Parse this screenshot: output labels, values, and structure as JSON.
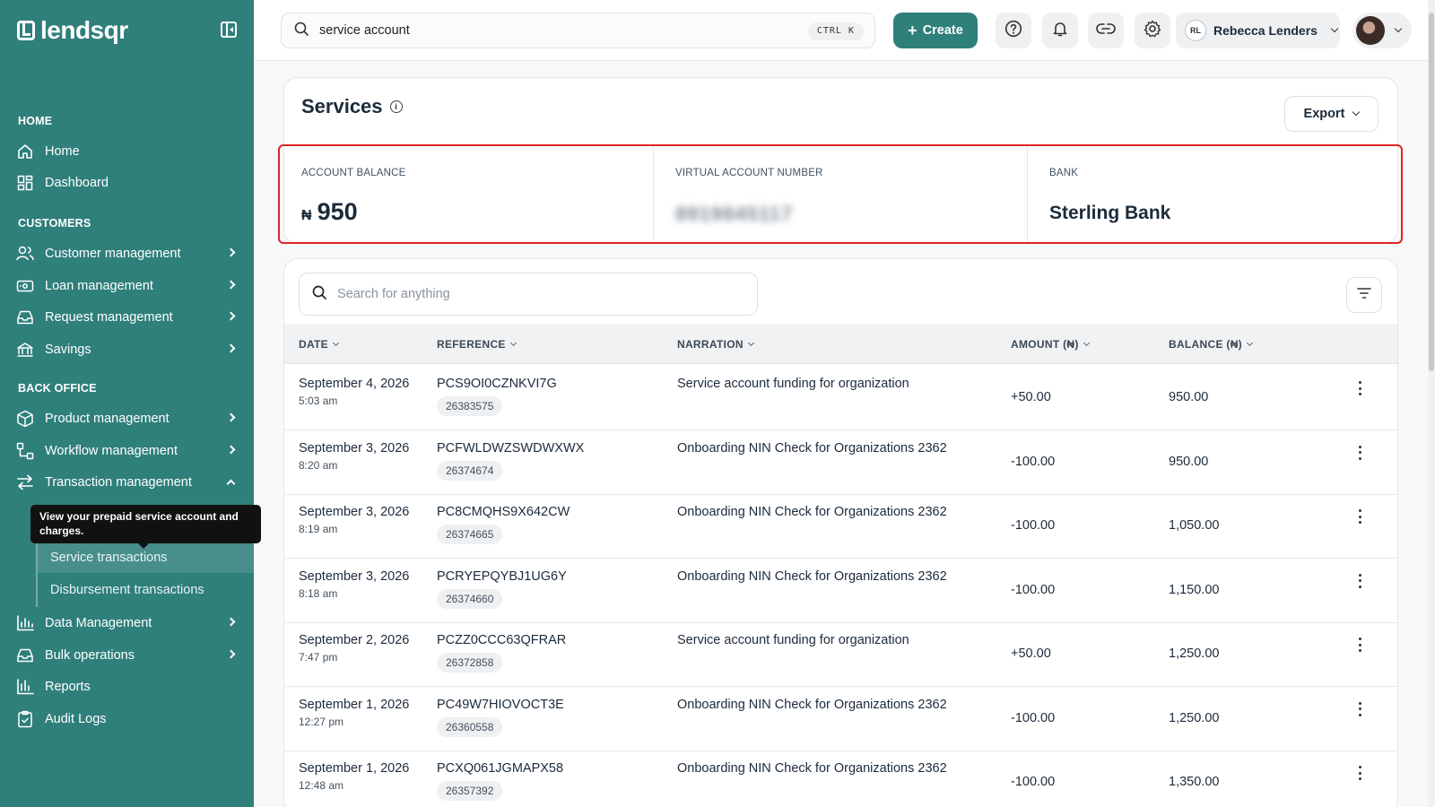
{
  "app": {
    "logo_text": "lendsqr"
  },
  "sidebar": {
    "sections": {
      "home": "HOME",
      "customers": "CUSTOMERS",
      "back_office": "BACK OFFICE"
    },
    "items": {
      "home": "Home",
      "dashboard": "Dashboard",
      "customer_management": "Customer management",
      "loan_management": "Loan management",
      "request_management": "Request management",
      "savings": "Savings",
      "product_management": "Product management",
      "workflow_management": "Workflow management",
      "transaction_management": "Transaction management",
      "service_transactions": "Service transactions",
      "disbursement_transactions": "Disbursement transactions",
      "data_management": "Data Management",
      "bulk_operations": "Bulk operations",
      "reports": "Reports",
      "audit_logs": "Audit Logs"
    },
    "tooltip": "View your prepaid service account and charges."
  },
  "topbar": {
    "search_value": "service account",
    "shortcut": "CTRL K",
    "create_label": "Create",
    "user_initials": "RL",
    "user_name": "Rebecca Lenders"
  },
  "page": {
    "title": "Services",
    "export_label": "Export"
  },
  "stats": {
    "balance_label": "ACCOUNT BALANCE",
    "currency_symbol": "₦",
    "balance_value": "950",
    "account_label": "VIRTUAL ACCOUNT NUMBER",
    "account_value": "8919845117",
    "bank_label": "BANK",
    "bank_value": "Sterling Bank"
  },
  "table": {
    "search_placeholder": "Search for anything",
    "columns": {
      "date": "DATE",
      "reference": "REFERENCE",
      "narration": "NARRATION",
      "amount": "AMOUNT (₦)",
      "balance": "BALANCE (₦)"
    },
    "rows": [
      {
        "date": "September 4, 2026",
        "time": "5:03 am",
        "reference": "PCS9OI0CZNKVI7G",
        "ref_id": "26383575",
        "narration": "Service account funding for organization",
        "amount": "+50.00",
        "balance": "950.00"
      },
      {
        "date": "September 3, 2026",
        "time": "8:20 am",
        "reference": "PCFWLDWZSWDWXWX",
        "ref_id": "26374674",
        "narration": "Onboarding NIN Check for Organizations 2362",
        "amount": "-100.00",
        "balance": "950.00"
      },
      {
        "date": "September 3, 2026",
        "time": "8:19 am",
        "reference": "PC8CMQHS9X642CW",
        "ref_id": "26374665",
        "narration": "Onboarding NIN Check for Organizations 2362",
        "amount": "-100.00",
        "balance": "1,050.00"
      },
      {
        "date": "September 3, 2026",
        "time": "8:18 am",
        "reference": "PCRYEPQYBJ1UG6Y",
        "ref_id": "26374660",
        "narration": "Onboarding NIN Check for Organizations 2362",
        "amount": "-100.00",
        "balance": "1,150.00"
      },
      {
        "date": "September 2, 2026",
        "time": "7:47 pm",
        "reference": "PCZZ0CCC63QFRAR",
        "ref_id": "26372858",
        "narration": "Service account funding for organization",
        "amount": "+50.00",
        "balance": "1,250.00"
      },
      {
        "date": "September 1, 2026",
        "time": "12:27 pm",
        "reference": "PC49W7HIOVOCT3E",
        "ref_id": "26360558",
        "narration": "Onboarding NIN Check for Organizations 2362",
        "amount": "-100.00",
        "balance": "1,250.00"
      },
      {
        "date": "September 1, 2026",
        "time": "12:48 am",
        "reference": "PCXQ061JGMAPX58",
        "ref_id": "26357392",
        "narration": "Onboarding NIN Check for Organizations 2362",
        "amount": "-100.00",
        "balance": "1,350.00"
      }
    ]
  },
  "colors": {
    "brand": "#2f7f7b",
    "highlight_border": "#e02424"
  }
}
